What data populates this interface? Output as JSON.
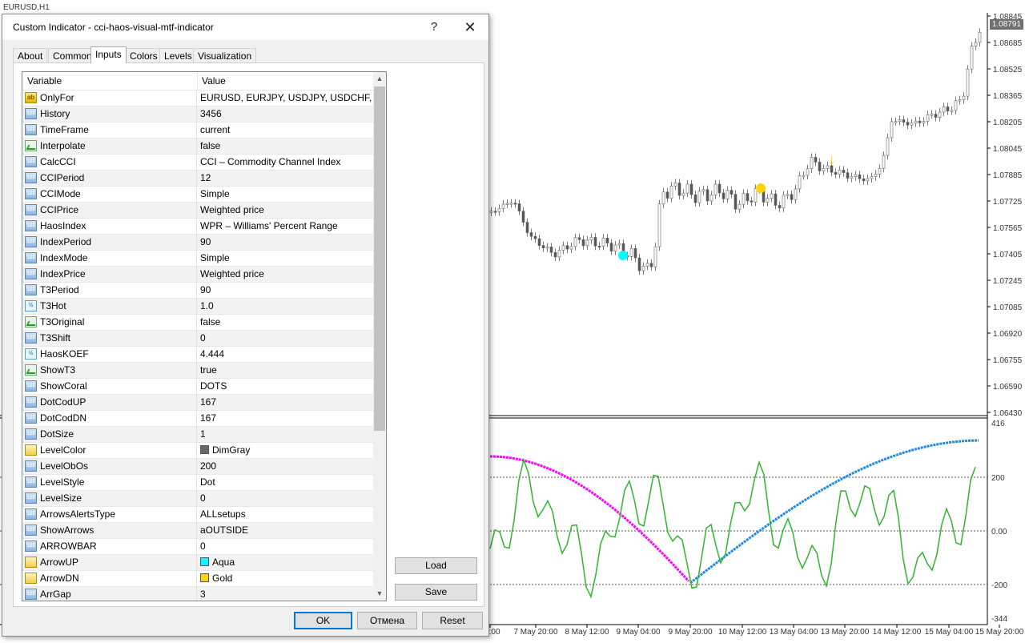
{
  "chart": {
    "symbol_title": "EURUSD,H1",
    "current_price": "1.08791",
    "price_ticks": [
      "1.08845",
      "1.08685",
      "1.08525",
      "1.08365",
      "1.08205",
      "1.08045",
      "1.07885",
      "1.07725",
      "1.07565",
      "1.07405",
      "1.07245",
      "1.07085",
      "1.06920",
      "1.06755",
      "1.06590",
      "1.06430"
    ],
    "indicator_ticks": [
      "416",
      "200",
      "0.00",
      "-200",
      "-344"
    ],
    "time_ticks": [
      "04:00",
      "7 May 20:00",
      "8 May 12:00",
      "9 May 04:00",
      "9 May 20:00",
      "10 May 12:00",
      "13 May 04:00",
      "13 May 20:00",
      "14 May 12:00",
      "15 May 04:00",
      "15 May 20:00"
    ],
    "colors": {
      "magenta_line": "#ff00ff",
      "blue_line": "#1e88e5",
      "green_line": "#2fb52f",
      "arrow_up": "#00ffff",
      "arrow_dn": "#ffd400"
    }
  },
  "dialog": {
    "title": "Custom Indicator - cci-haos-visual-mtf-indicator",
    "help_label": "?",
    "close_label": "✕",
    "tabs": [
      "About",
      "Common",
      "Inputs",
      "Colors",
      "Levels",
      "Visualization"
    ],
    "active_tab": "Inputs",
    "columns": {
      "variable": "Variable",
      "value": "Value"
    },
    "params": [
      {
        "name": "OnlyFor",
        "value": "EURUSD, EURJPY, USDJPY, USDCHF, ...",
        "type": "ab"
      },
      {
        "name": "History",
        "value": "3456",
        "type": "int"
      },
      {
        "name": "TimeFrame",
        "value": "current",
        "type": "int"
      },
      {
        "name": "Interpolate",
        "value": "false",
        "type": "bool"
      },
      {
        "name": "CalcCCI",
        "value": "CCI – Commodity Channel Index",
        "type": "int"
      },
      {
        "name": "CCIPeriod",
        "value": "12",
        "type": "int"
      },
      {
        "name": "CCIMode",
        "value": "Simple",
        "type": "int"
      },
      {
        "name": "CCIPrice",
        "value": "Weighted price",
        "type": "int"
      },
      {
        "name": "HaosIndex",
        "value": "WPR – Williams' Percent Range",
        "type": "int"
      },
      {
        "name": "IndexPeriod",
        "value": "90",
        "type": "int"
      },
      {
        "name": "IndexMode",
        "value": "Simple",
        "type": "int"
      },
      {
        "name": "IndexPrice",
        "value": "Weighted price",
        "type": "int"
      },
      {
        "name": "T3Period",
        "value": "90",
        "type": "int"
      },
      {
        "name": "T3Hot",
        "value": "1.0",
        "type": "dbl"
      },
      {
        "name": "T3Original",
        "value": "false",
        "type": "bool"
      },
      {
        "name": "T3Shift",
        "value": "0",
        "type": "int"
      },
      {
        "name": "HaosKOEF",
        "value": "4.444",
        "type": "dbl"
      },
      {
        "name": "ShowT3",
        "value": "true",
        "type": "bool"
      },
      {
        "name": "ShowCoral",
        "value": "DOTS",
        "type": "int"
      },
      {
        "name": "DotCodUP",
        "value": "167",
        "type": "int"
      },
      {
        "name": "DotCodDN",
        "value": "167",
        "type": "int"
      },
      {
        "name": "DotSize",
        "value": "1",
        "type": "int"
      },
      {
        "name": "LevelColor",
        "value": "DimGray",
        "type": "col",
        "swatch": "#696969"
      },
      {
        "name": "LevelObOs",
        "value": "200",
        "type": "int"
      },
      {
        "name": "LevelStyle",
        "value": "Dot",
        "type": "int"
      },
      {
        "name": "LevelSize",
        "value": "0",
        "type": "int"
      },
      {
        "name": "ArrowsAlertsType",
        "value": "ALLsetups",
        "type": "int"
      },
      {
        "name": "ShowArrows",
        "value": "aOUTSIDE",
        "type": "int"
      },
      {
        "name": "ARROWBAR",
        "value": "0",
        "type": "int"
      },
      {
        "name": "ArrowUP",
        "value": "Aqua",
        "type": "col",
        "swatch": "#00ffff"
      },
      {
        "name": "ArrowDN",
        "value": "Gold",
        "type": "col",
        "swatch": "#ffd700"
      },
      {
        "name": "ArrGap",
        "value": "3",
        "type": "int"
      }
    ],
    "load_label": "Load",
    "save_label": "Save",
    "ok_label": "OK",
    "cancel_label": "Отмена",
    "reset_label": "Reset"
  }
}
